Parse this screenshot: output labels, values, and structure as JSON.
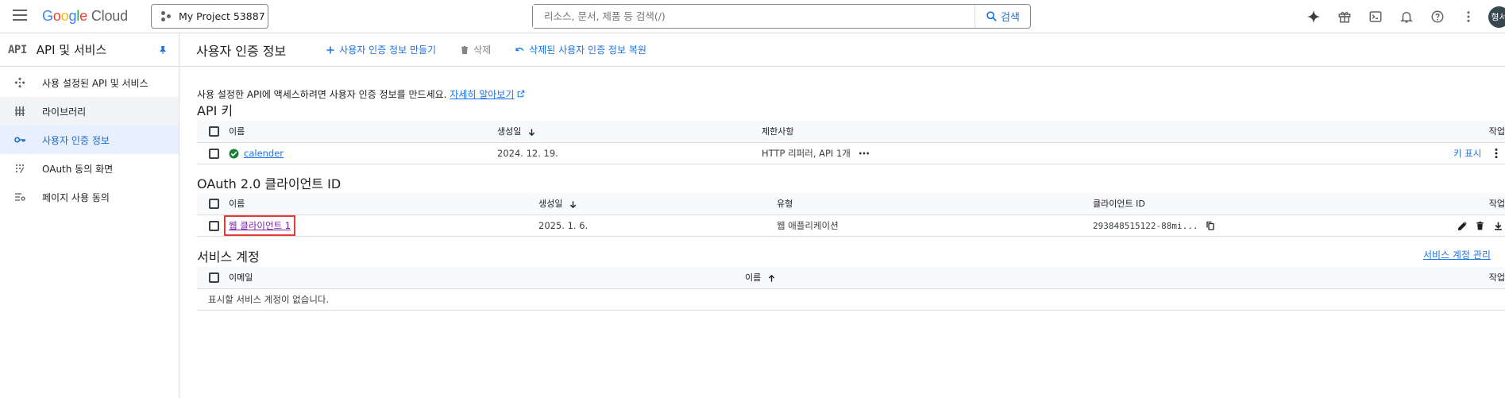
{
  "topbar": {
    "logo_google": [
      "G",
      "o",
      "o",
      "g",
      "l",
      "e"
    ],
    "logo_cloud": "Cloud",
    "project": "My Project 53887",
    "search_placeholder": "리소스, 문서, 제품 등 검색(/)",
    "search_button": "검색",
    "avatar_text": "형서",
    "icons": [
      "gemini-icon",
      "gift-icon",
      "terminal-icon",
      "bell-icon",
      "help-icon",
      "more-vert-icon"
    ]
  },
  "sidebar": {
    "badge": "API",
    "title": "API 및 서비스",
    "items": [
      {
        "label": "사용 설정된 API 및 서비스",
        "icon": "api-hub-icon"
      },
      {
        "label": "라이브러리",
        "icon": "library-icon"
      },
      {
        "label": "사용자 인증 정보",
        "icon": "key-icon"
      },
      {
        "label": "OAuth 동의 화면",
        "icon": "consent-icon"
      },
      {
        "label": "페이지 사용 동의",
        "icon": "settings-list-icon"
      }
    ]
  },
  "main": {
    "title": "사용자 인증 정보",
    "actions": {
      "create": "사용자 인증 정보 만들기",
      "delete": "삭제",
      "restore": "삭제된 사용자 인증 정보 복원"
    },
    "intro_text": "사용 설정한 API에 액세스하려면 사용자 인증 정보를 만드세요.",
    "intro_link": "자세히 알아보기",
    "api_keys": {
      "title": "API 키",
      "headers": {
        "name": "이름",
        "created": "생성일",
        "restrictions": "제한사항",
        "actions": "작업"
      },
      "rows": [
        {
          "name": "calender",
          "created": "2024. 12. 19.",
          "restrictions": "HTTP 리퍼러, API 1개",
          "show_key": "키 표시"
        }
      ]
    },
    "oauth": {
      "title": "OAuth 2.0 클라이언트 ID",
      "headers": {
        "name": "이름",
        "created": "생성일",
        "type": "유형",
        "client_id": "클라이언트 ID",
        "actions": "작업"
      },
      "rows": [
        {
          "name": "웹 클라이언트 1",
          "created": "2025. 1. 6.",
          "type": "웹 애플리케이션",
          "client_id": "293848515122-88mi..."
        }
      ]
    },
    "service_accounts": {
      "title": "서비스 계정",
      "manage_link": "서비스 계정 관리",
      "headers": {
        "email": "이메일",
        "name": "이름",
        "actions": "작업"
      },
      "empty": "표시할 서비스 계정이 없습니다."
    }
  }
}
